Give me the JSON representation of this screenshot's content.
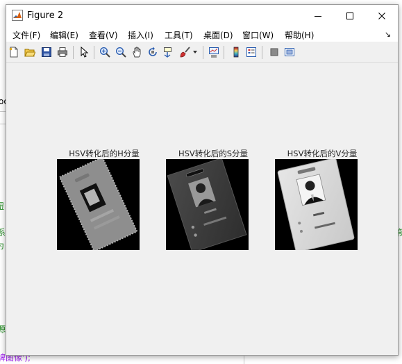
{
  "window": {
    "title": "Figure 2",
    "controls": [
      "minimize",
      "maximize",
      "close"
    ]
  },
  "menu": {
    "items": [
      "文件(F)",
      "编辑(E)",
      "查看(V)",
      "插入(I)",
      "工具(T)",
      "桌面(D)",
      "窗口(W)",
      "帮助(H)"
    ],
    "overflow": "↘"
  },
  "toolbar": {
    "icons": [
      "new-figure-icon",
      "open-file-icon",
      "save-icon",
      "print-icon",
      "select-arrow-icon",
      "zoom-in-icon",
      "zoom-out-icon",
      "pan-icon",
      "rotate-3d-icon",
      "data-cursor-icon",
      "brush-icon",
      "link-plot-icon",
      "insert-colorbar-icon",
      "insert-legend-icon",
      "hide-plot-tools-icon",
      "show-plot-tools-icon"
    ]
  },
  "plots": [
    {
      "title": "HSV转化后的H分量"
    },
    {
      "title": "HSV转化后的S分量"
    },
    {
      "title": "HSV转化后的V分量"
    }
  ],
  "background": {
    "fragments": [
      "od",
      "纽",
      "系",
      "为",
      "第",
      "源",
      "牌图像');"
    ]
  },
  "colors": {
    "window_bg": "#f0f0f0",
    "titlebar_bg": "#ffffff",
    "axes_bg": "#000000"
  }
}
